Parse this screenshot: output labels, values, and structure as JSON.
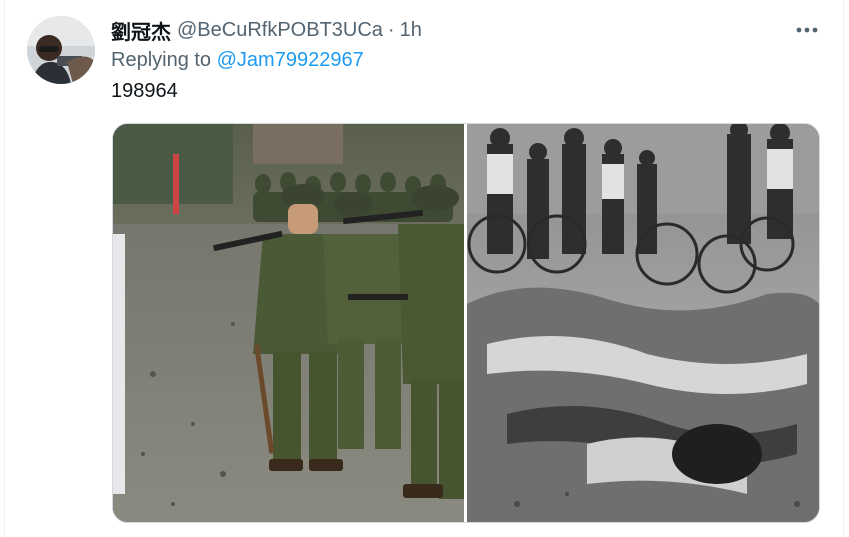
{
  "tweet": {
    "display_name": "劉冠杰",
    "handle": "@BeCuRfkPOBT3UCa",
    "separator": "·",
    "time": "1h",
    "replying_prefix": "Replying to",
    "replying_to": "@Jam79922967",
    "text": "198964"
  },
  "icons": {
    "more": "more-horizontal-icon",
    "avatar": "user-avatar-photo"
  },
  "colors": {
    "text_primary": "#0f1419",
    "text_secondary": "#536471",
    "link": "#1d9bf0",
    "border": "#cfd9de"
  }
}
